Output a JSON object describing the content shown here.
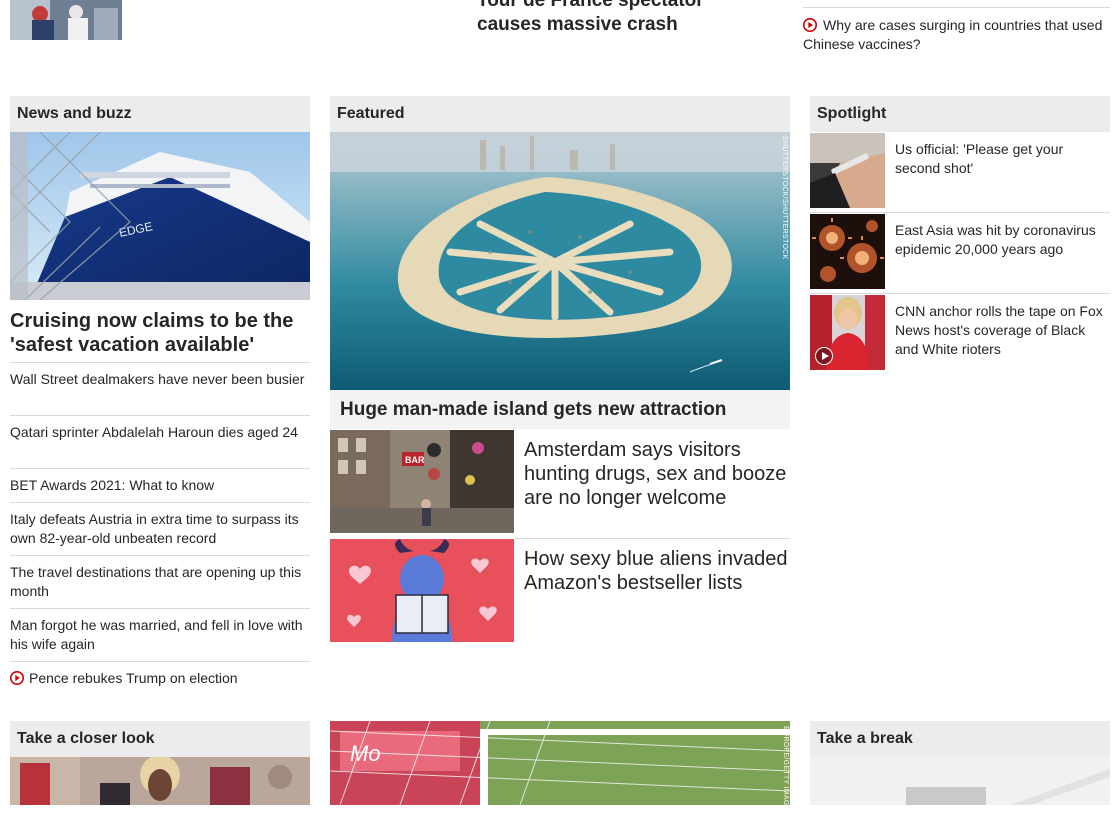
{
  "top": {
    "headline_line1": "Tour de France spectator",
    "headline_line2": "causes massive crash",
    "video_link": "Why are cases surging in countries that used Chinese vaccines?"
  },
  "news_and_buzz": {
    "header": "News and buzz",
    "lead_headline": "Cruising now claims to be the 'safest vacation available'",
    "items": [
      {
        "text": "Wall Street dealmakers have never been busier",
        "video": false
      },
      {
        "text": "Qatari sprinter Abdalelah Haroun dies aged 24",
        "video": false
      },
      {
        "text": "BET Awards 2021: What to know",
        "video": false
      },
      {
        "text": "Italy defeats Austria in extra time to surpass its own 82-year-old unbeaten record",
        "video": false
      },
      {
        "text": "The travel destinations that are opening up this month",
        "video": false
      },
      {
        "text": "Man forgot he was married, and fell in love with his wife again",
        "video": false
      },
      {
        "text": "Pence rebukes Trump on election",
        "video": true
      }
    ]
  },
  "featured": {
    "header": "Featured",
    "lead_caption": "Huge man-made island gets new attraction",
    "lead_credit": "SHUTTERSTOCK/SHUTTERSTOCK",
    "stories": [
      {
        "text": "Amsterdam says visitors hunting drugs, sex and booze are no longer welcome"
      },
      {
        "text": "How sexy blue aliens invaded Amazon's bestseller lists"
      }
    ]
  },
  "spotlight": {
    "header": "Spotlight",
    "items": [
      {
        "text": "Us official: 'Please get your second shot'",
        "video": false
      },
      {
        "text": "East Asia was hit by coronavirus epidemic 20,000 years ago",
        "video": false
      },
      {
        "text": "CNN anchor rolls the tape on Fox News host's coverage of Black and White rioters",
        "video": true
      }
    ]
  },
  "bottom": {
    "left_header": "Take a closer look",
    "right_header": "Take a break",
    "center_credit": "EUROPE/GETTY IMAGES"
  },
  "colors": {
    "video_red": "#cc0000",
    "header_bg": "#ececec",
    "rule": "#d9d9d9"
  }
}
